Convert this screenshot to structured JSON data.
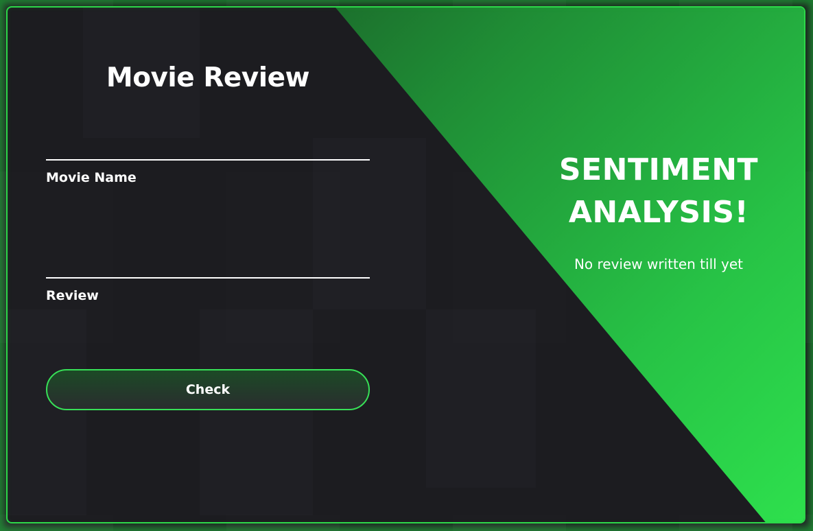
{
  "form": {
    "title": "Movie Review",
    "movie_name_label": "Movie Name",
    "movie_name_value": "",
    "review_label": "Review",
    "review_value": "",
    "submit_label": "Check"
  },
  "result_panel": {
    "heading_line1": "SENTIMENT",
    "heading_line2": "ANALYSIS!",
    "result_text": "No review written till yet"
  },
  "colors": {
    "accent": "#2edb4b",
    "background": "#1c1c20",
    "text": "#ffffff"
  }
}
